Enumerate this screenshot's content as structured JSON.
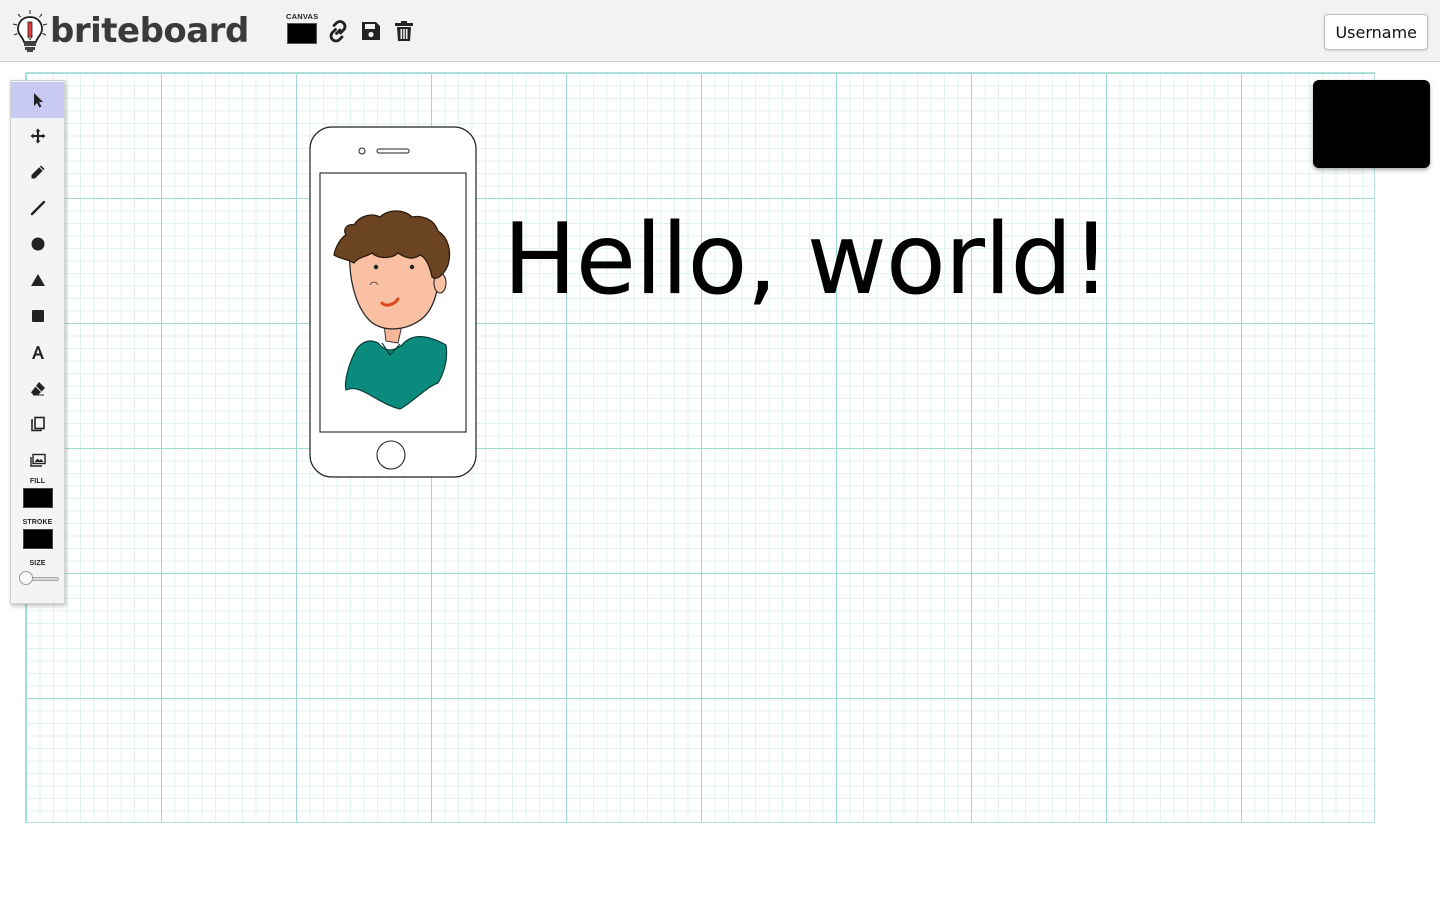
{
  "app": {
    "name": "briteboard",
    "logo_icon": "lightbulb-pencil-icon"
  },
  "header": {
    "canvas_label": "CANVAS",
    "canvas_color": "#000000",
    "buttons": [
      {
        "name": "share-link-button",
        "icon": "link-icon"
      },
      {
        "name": "save-button",
        "icon": "floppy-disk-icon"
      },
      {
        "name": "delete-button",
        "icon": "trash-icon"
      }
    ],
    "username": "Username"
  },
  "toolbar": {
    "tools": [
      {
        "name": "select",
        "icon": "cursor-arrow-icon",
        "active": true
      },
      {
        "name": "move",
        "icon": "move-arrows-icon",
        "active": false
      },
      {
        "name": "pencil",
        "icon": "pencil-icon",
        "active": false
      },
      {
        "name": "line",
        "icon": "line-icon",
        "active": false
      },
      {
        "name": "circle",
        "icon": "circle-icon",
        "active": false
      },
      {
        "name": "triangle",
        "icon": "triangle-icon",
        "active": false
      },
      {
        "name": "rectangle",
        "icon": "square-icon",
        "active": false
      },
      {
        "name": "text",
        "icon": "text-a-icon",
        "active": false
      },
      {
        "name": "eraser",
        "icon": "eraser-icon",
        "active": false
      },
      {
        "name": "copy",
        "icon": "copy-icon",
        "active": false
      },
      {
        "name": "image",
        "icon": "image-icon",
        "active": false
      }
    ],
    "fill_label": "FILL",
    "fill_color": "#000000",
    "stroke_label": "STROKE",
    "stroke_color": "#000000",
    "size_label": "SIZE",
    "size_value": 0
  },
  "board": {
    "text": "Hello, world!",
    "grid_color": "#9fdad1",
    "preview_color": "#000000"
  }
}
